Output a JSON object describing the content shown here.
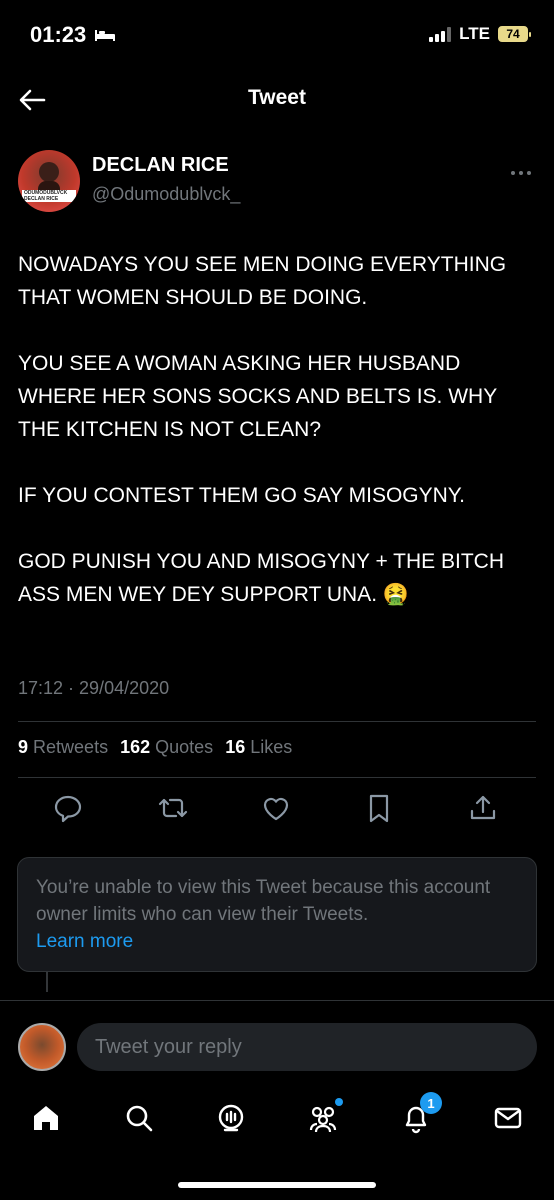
{
  "status_bar": {
    "time": "01:23",
    "network": "LTE",
    "battery": "74"
  },
  "header": {
    "title": "Tweet"
  },
  "tweet": {
    "display_name": "DECLAN RICE",
    "handle": "@Odumodublvck_",
    "avatar_band_text": "ODUMODUBLVCK DECLAN RICE",
    "paragraphs": [
      "NOWADAYS YOU SEE MEN DOING EVERYTHING THAT WOMEN SHOULD BE DOING.",
      "YOU SEE A WOMAN ASKING HER HUSBAND WHERE HER SONS SOCKS AND BELTS IS. WHY THE KITCHEN IS NOT CLEAN?",
      "IF YOU CONTEST THEM GO SAY MISOGYNY.",
      "GOD PUNISH YOU AND MISOGYNY + THE BITCH ASS MEN WEY DEY SUPPORT UNA. 🤮"
    ],
    "timestamp": "17:12 · 29/04/2020",
    "stats": {
      "retweets_count": "9",
      "retweets_label": "Retweets",
      "quotes_count": "162",
      "quotes_label": "Quotes",
      "likes_count": "16",
      "likes_label": "Likes"
    },
    "notice": {
      "text": "You’re unable to view this Tweet because this account owner limits who can view their Tweets.",
      "link": "Learn more"
    }
  },
  "reply": {
    "placeholder": "Tweet your reply"
  },
  "nav": {
    "notifications_badge": "1"
  },
  "colors": {
    "background": "#000000",
    "accent": "#1d9bf0",
    "muted": "#71767b"
  }
}
